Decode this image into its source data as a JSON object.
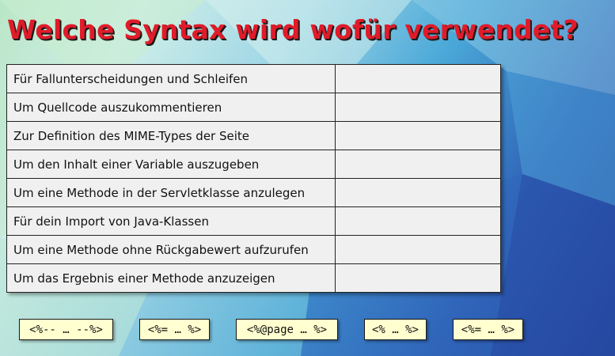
{
  "title": "Welche Syntax wird wofür verwendet?",
  "rows": [
    {
      "label": "Für Fallunterscheidungen und Schleifen",
      "answer": ""
    },
    {
      "label": "Um Quellcode auszukommentieren",
      "answer": ""
    },
    {
      "label": "Zur Definition des MIME-Types der Seite",
      "answer": ""
    },
    {
      "label": "Um den Inhalt einer Variable auszugeben",
      "answer": ""
    },
    {
      "label": "Um eine Methode in der Servletklasse anzulegen",
      "answer": ""
    },
    {
      "label": "Für dein Import von Java-Klassen",
      "answer": ""
    },
    {
      "label": "Um eine Methode ohne Rückgabewert aufzurufen",
      "answer": ""
    },
    {
      "label": "Um das Ergebnis einer Methode anzuzeigen",
      "answer": ""
    }
  ],
  "chips": [
    "<%-- … --%>",
    "<%= … %>",
    "<%@page … %>",
    "<% … %>",
    "<%= … %>"
  ],
  "colors": {
    "title": "#e01b2a",
    "chip_background": "#ffffcf",
    "table_background": "#f0f0f0"
  }
}
